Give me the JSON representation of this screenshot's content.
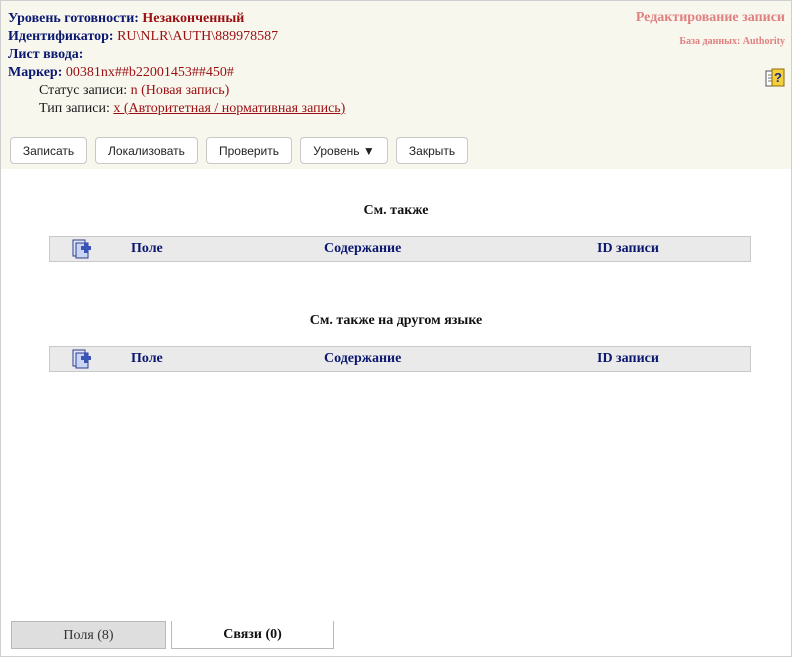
{
  "record": {
    "level_label": "Уровень готовности:",
    "level_value": "Незаконченный",
    "id_label": "Идентификатор:",
    "id_value": "RU\\NLR\\AUTH\\889978587",
    "sheet_label": "Лист ввода:",
    "marker_label": "Маркер:",
    "marker_value": "00381nx##b22001453##450#",
    "status_label": "Статус записи:",
    "status_value": "n (Новая запись)",
    "type_label": "Тип записи:",
    "type_value": "x (Авторитетная / нормативная запись)"
  },
  "header_right": {
    "title": "Редактирование записи",
    "db": "База данных: Authority"
  },
  "toolbar": {
    "save": "Записать",
    "localize": "Локализовать",
    "check": "Проверить",
    "level": "Уровень ▼",
    "close": "Закрыть"
  },
  "sections": [
    {
      "title": "См. также",
      "columns": [
        "Поле",
        "Содержание",
        "ID записи"
      ]
    },
    {
      "title": "См. также на другом языке",
      "columns": [
        "Поле",
        "Содержание",
        "ID записи"
      ]
    }
  ],
  "tabs": {
    "fields": "Поля (8)",
    "links": "Связи (0)"
  },
  "icons": {
    "help": "help-icon",
    "add": "add-row-icon"
  }
}
